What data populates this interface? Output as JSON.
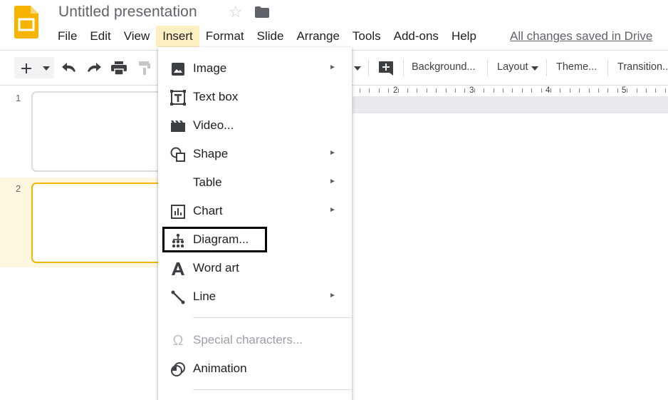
{
  "header": {
    "doc_title": "Untitled presentation",
    "save_status": "All changes saved in Drive",
    "icons": {
      "logo": "google-slides-logo",
      "star": "star-icon",
      "folder": "folder-icon"
    }
  },
  "menubar": {
    "items": [
      "File",
      "Edit",
      "View",
      "Insert",
      "Format",
      "Slide",
      "Arrange",
      "Tools",
      "Add-ons",
      "Help"
    ],
    "active": "Insert"
  },
  "toolbar": {
    "background_label": "Background...",
    "layout_label": "Layout",
    "theme_label": "Theme...",
    "transition_label": "Transition..."
  },
  "slides": [
    {
      "number": "1",
      "selected": false
    },
    {
      "number": "2",
      "selected": true
    }
  ],
  "ruler": {
    "labels": [
      "2",
      "3",
      "4",
      "5"
    ]
  },
  "insert_menu": {
    "items": [
      {
        "label": "Image",
        "icon": "image-icon",
        "submenu": true
      },
      {
        "label": "Text box",
        "icon": "text-box-icon",
        "submenu": false
      },
      {
        "label": "Video...",
        "icon": "video-icon",
        "submenu": false
      },
      {
        "label": "Shape",
        "icon": "shape-icon",
        "submenu": true
      },
      {
        "label": "Table",
        "icon": "",
        "submenu": true
      },
      {
        "label": "Chart",
        "icon": "chart-icon",
        "submenu": true
      },
      {
        "label": "Diagram...",
        "icon": "diagram-icon",
        "submenu": false
      },
      {
        "label": "Word art",
        "icon": "word-art-icon",
        "submenu": false
      },
      {
        "label": "Line",
        "icon": "line-icon",
        "submenu": true
      },
      {
        "label": "Special characters...",
        "icon": "omega-icon",
        "submenu": false,
        "disabled": true
      },
      {
        "label": "Animation",
        "icon": "animation-icon",
        "submenu": false
      }
    ],
    "highlighted": "Diagram...",
    "arrow_glyph": "►"
  },
  "colors": {
    "active_menu_bg": "#feefc3",
    "selected_slide_border": "#f4b400",
    "selected_slide_row_bg": "#fef7e0",
    "logo_yellow": "#f4b400"
  }
}
